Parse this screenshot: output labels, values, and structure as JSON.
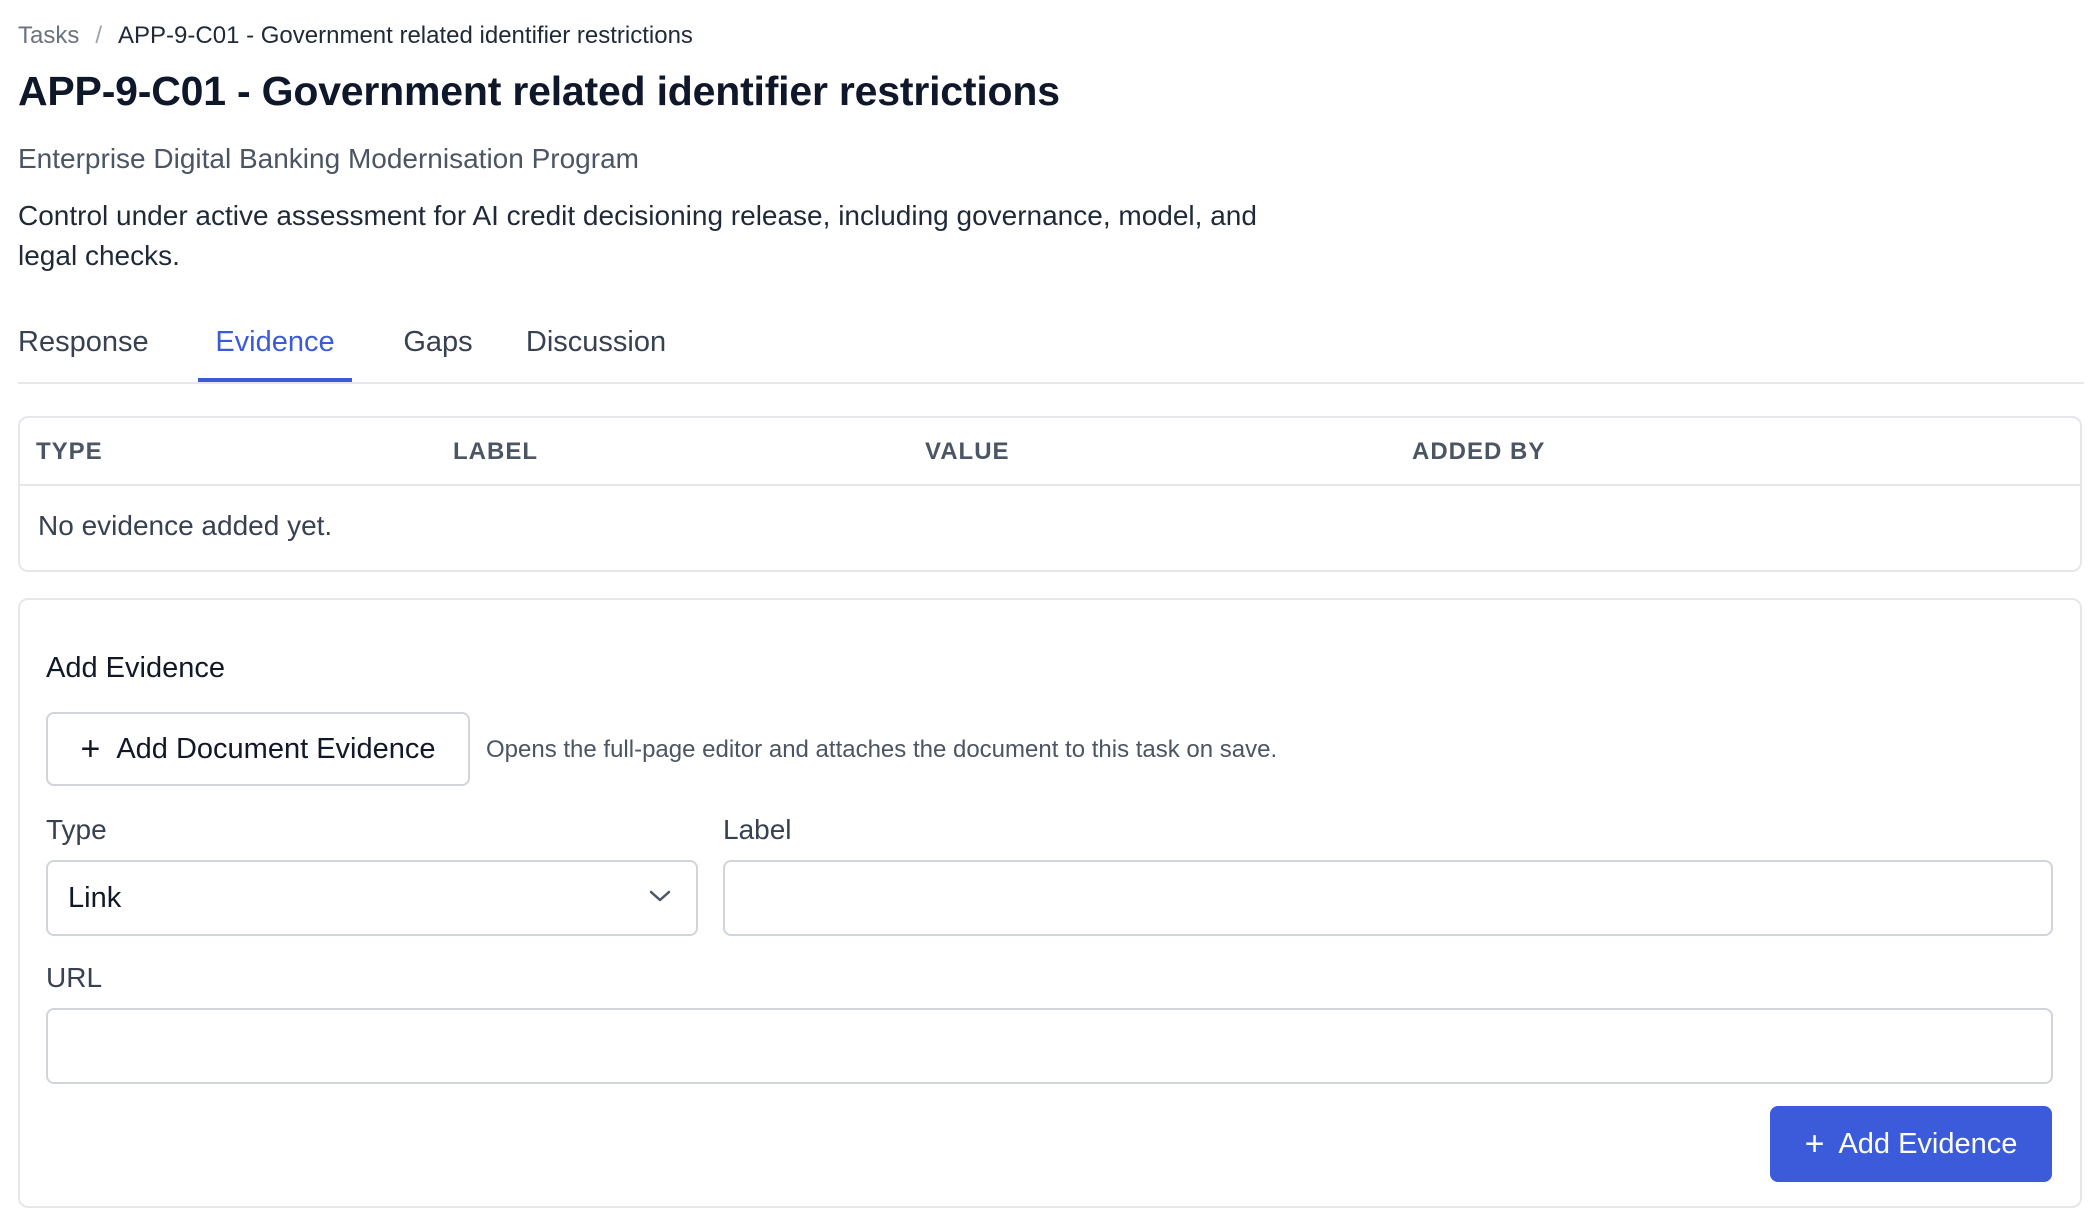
{
  "breadcrumb": {
    "root": "Tasks",
    "separator": "/",
    "current": "APP-9-C01 - Government related identifier restrictions"
  },
  "page": {
    "title": "APP-9-C01 - Government related identifier restrictions",
    "program": "Enterprise Digital Banking Modernisation Program",
    "description": "Control under active assessment for AI credit decisioning release, including governance, model, and legal checks."
  },
  "tabs": [
    {
      "label": "Response",
      "active": false
    },
    {
      "label": "Evidence",
      "active": true
    },
    {
      "label": "Gaps",
      "active": false
    },
    {
      "label": "Discussion",
      "active": false
    }
  ],
  "evidence_table": {
    "columns": [
      "TYPE",
      "LABEL",
      "VALUE",
      "ADDED BY"
    ],
    "rows": [],
    "empty_message": "No evidence added yet."
  },
  "add_form": {
    "title": "Add Evidence",
    "document_button": {
      "icon": "plus-icon",
      "label": "Add Document Evidence"
    },
    "document_help": "Opens the full-page editor and attaches the document to this task on save.",
    "type": {
      "label": "Type",
      "value": "Link",
      "icon": "chevron-down-icon"
    },
    "label_field": {
      "label": "Label",
      "value": ""
    },
    "url_field": {
      "label": "URL",
      "value": ""
    },
    "submit_button": {
      "icon": "plus-icon",
      "label": "Add Evidence"
    }
  },
  "colors": {
    "accent": "#3b5bdb",
    "border": "#e5e7eb",
    "text_primary": "#111827",
    "text_secondary": "#4b5563"
  }
}
